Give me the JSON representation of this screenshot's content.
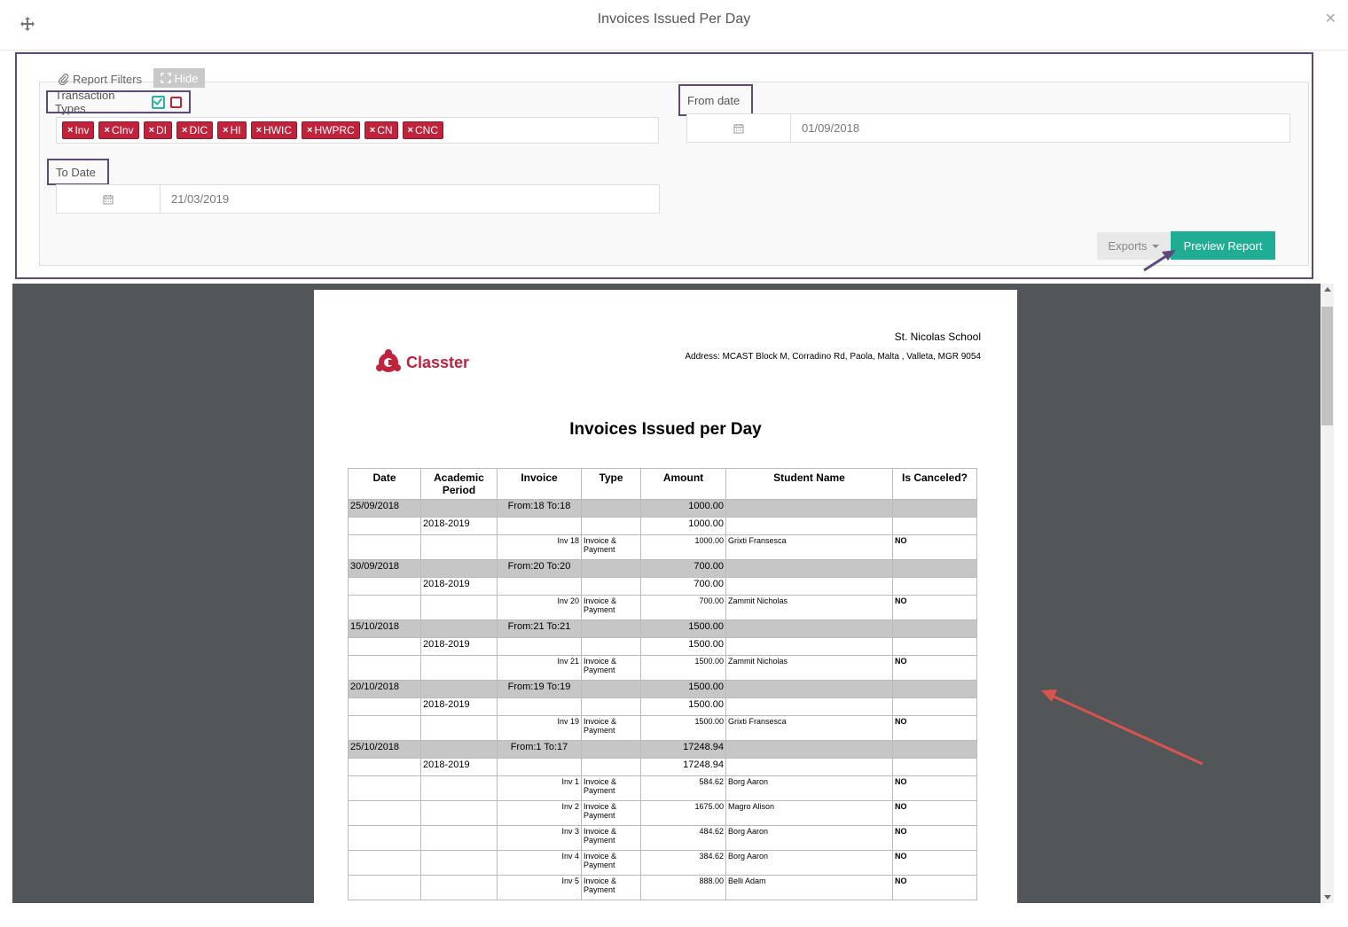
{
  "dialog": {
    "title": "Invoices Issued Per Day"
  },
  "filters": {
    "tab_label": "Report Filters",
    "hide_label": "Hide",
    "transaction_types_label": "Transaction Types",
    "tags": [
      "Inv",
      "CInv",
      "DI",
      "DIC",
      "HI",
      "HWIC",
      "HWPRC",
      "CN",
      "CNC"
    ],
    "from_date_label": "From date",
    "from_date_value": "01/09/2018",
    "to_date_label": "To Date",
    "to_date_value": "21/03/2019",
    "exports_label": "Exports",
    "preview_label": "Preview Report"
  },
  "report": {
    "logo_text": "Classter",
    "school_name": "St. Nicolas School",
    "address": "Address: MCAST Block M, Corradino Rd, Paola, Malta , Valleta, MGR 9054",
    "title": "Invoices Issued per Day",
    "headers": [
      "Date",
      "Academic Period",
      "Invoice",
      "Type",
      "Amount",
      "Student Name",
      "Is Canceled?"
    ],
    "groups": [
      {
        "date": "25/09/2018",
        "range": "From:18 To:18",
        "total": "1000.00",
        "period": "2018-2019",
        "period_total": "1000.00",
        "invoices": [
          {
            "invoice": "Inv 18",
            "type": "Invoice & Payment",
            "amount": "1000.00",
            "student": "Grixti Fransesca",
            "canceled": "NO"
          }
        ]
      },
      {
        "date": "30/09/2018",
        "range": "From:20 To:20",
        "total": "700.00",
        "period": "2018-2019",
        "period_total": "700.00",
        "invoices": [
          {
            "invoice": "Inv 20",
            "type": "Invoice & Payment",
            "amount": "700.00",
            "student": "Zammit Nicholas",
            "canceled": "NO"
          }
        ]
      },
      {
        "date": "15/10/2018",
        "range": "From:21 To:21",
        "total": "1500.00",
        "period": "2018-2019",
        "period_total": "1500.00",
        "invoices": [
          {
            "invoice": "Inv 21",
            "type": "Invoice & Payment",
            "amount": "1500.00",
            "student": "Zammit Nicholas",
            "canceled": "NO"
          }
        ]
      },
      {
        "date": "20/10/2018",
        "range": "From:19 To:19",
        "total": "1500.00",
        "period": "2018-2019",
        "period_total": "1500.00",
        "invoices": [
          {
            "invoice": "Inv 19",
            "type": "Invoice & Payment",
            "amount": "1500.00",
            "student": "Grixti Fransesca",
            "canceled": "NO"
          }
        ]
      },
      {
        "date": "25/10/2018",
        "range": "From:1 To:17",
        "total": "17248.94",
        "period": "2018-2019",
        "period_total": "17248.94",
        "invoices": [
          {
            "invoice": "Inv 1",
            "type": "Invoice & Payment",
            "amount": "584.62",
            "student": "Borg Aaron",
            "canceled": "NO"
          },
          {
            "invoice": "Inv 2",
            "type": "Invoice & Payment",
            "amount": "1675.00",
            "student": "Magro Alison",
            "canceled": "NO"
          },
          {
            "invoice": "Inv 3",
            "type": "Invoice & Payment",
            "amount": "484.62",
            "student": "Borg Aaron",
            "canceled": "NO"
          },
          {
            "invoice": "Inv 4",
            "type": "Invoice & Payment",
            "amount": "384.62",
            "student": "Borg Aaron",
            "canceled": "NO"
          },
          {
            "invoice": "Inv 5",
            "type": "Invoice & Payment",
            "amount": "888.00",
            "student": "Belli Adam",
            "canceled": "NO"
          }
        ]
      }
    ]
  },
  "colors": {
    "accent": "#1fae93",
    "tag": "#c0243c",
    "highlight_frame": "#5c4a7a",
    "annotation_arrow": "#d9534f"
  }
}
